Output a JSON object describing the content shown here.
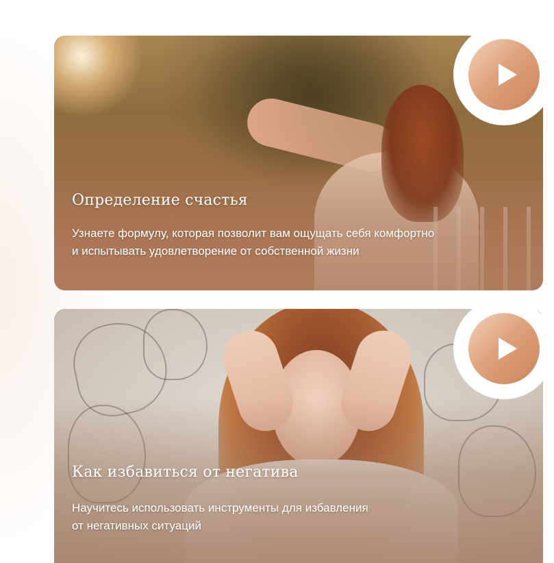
{
  "cards": [
    {
      "title": "Определение счастья",
      "description_line1": "Узнаете формулу, которая позволит вам ощущать себя комфортно",
      "description_line2": "и испытывать удовлетворение от собственной жизни",
      "play_icon": "play-icon"
    },
    {
      "title": "Как избавиться от негатива",
      "description_line1": "Научитесь использовать инструменты для избавления",
      "description_line2": "от негативных ситуаций",
      "play_icon": "play-icon"
    }
  ],
  "colors": {
    "accent_gradient_start": "#f3d2bb",
    "accent_gradient_end": "#c9845a",
    "text": "#ffffff",
    "background": "#ffffff"
  }
}
